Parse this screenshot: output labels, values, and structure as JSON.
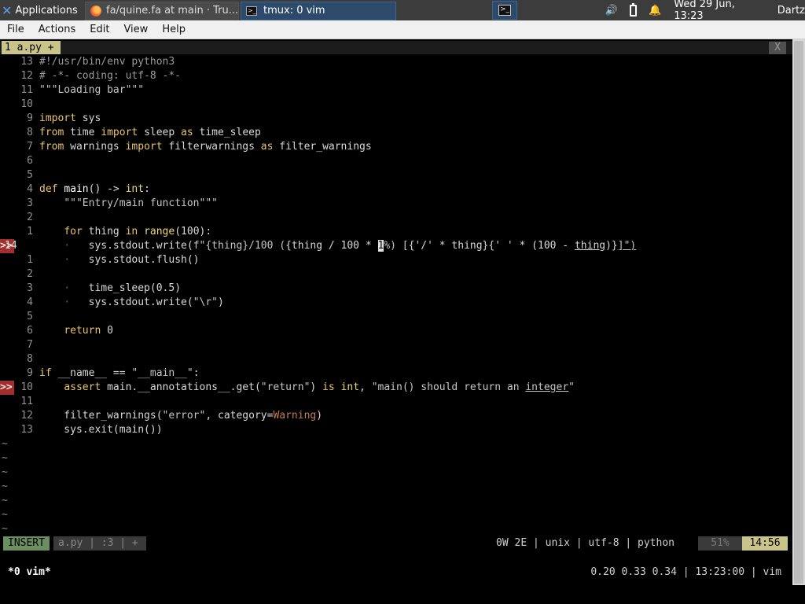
{
  "taskbar": {
    "apps_label": "Applications",
    "firefox_title": "fa/quine.fa at main · Tru...",
    "tmux_title": "tmux: 0 vim",
    "clock": "Wed 29 Jun, 13:23",
    "user": "Dartz"
  },
  "menubar": {
    "file": "File",
    "actions": "Actions",
    "edit": "Edit",
    "view": "View",
    "help": "Help"
  },
  "vim": {
    "tab_label": "1 a.py +",
    "tab_close": "X",
    "lines": [
      {
        "n": "13",
        "html": "<span class=\"cmt\">#!/usr/bin/env python3</span>"
      },
      {
        "n": "12",
        "html": "<span class=\"cmt\"># -*- coding: utf-8 -*-</span>"
      },
      {
        "n": "11",
        "html": "<span class=\"str\">\"\"\"Loading bar\"\"\"</span>"
      },
      {
        "n": "10",
        "html": ""
      },
      {
        "n": "9",
        "html": "<span class=\"kw\">import</span> sys"
      },
      {
        "n": "8",
        "html": "<span class=\"kw\">from</span> time <span class=\"kw\">import</span> sleep <span class=\"kw\">as</span> time_sleep"
      },
      {
        "n": "7",
        "html": "<span class=\"kw\">from</span> warnings <span class=\"kw\">import</span> filterwarnings <span class=\"kw\">as</span> filter_warnings"
      },
      {
        "n": "6",
        "html": ""
      },
      {
        "n": "5",
        "html": ""
      },
      {
        "n": "4",
        "html": "<span class=\"kw\">def</span> <span class=\"fn\">main</span>() -&gt; <span class=\"kw2\">int</span>:"
      },
      {
        "n": "3",
        "html": "    <span class=\"str\">\"\"\"Entry/main function\"\"\"</span>"
      },
      {
        "n": "2",
        "html": ""
      },
      {
        "n": "1",
        "html": "    <span class=\"kw\">for</span> thing <span class=\"kw\">in</span> <span class=\"kw2\">range</span>(100):"
      },
      {
        "n": "14",
        "cur": true,
        "sign": ">>",
        "html": "    <span class=\"dot\">·</span>   sys.stdout.write(<span class=\"str\">f\"{thing}/100 (</span>{thing / 100 * <span class=\"cursor\">1</span><span class=\"str\">%) [</span>{'/' * thing}{' ' * (100 - <span class=\"ul\">thing</span>)}<span class=\"str ul\">]\")</span>"
      },
      {
        "n": "1",
        "html": "    <span class=\"dot\">·</span>   sys.stdout.flush()"
      },
      {
        "n": "2",
        "html": ""
      },
      {
        "n": "3",
        "html": "    <span class=\"dot\">·</span>   time_sleep(0.5)"
      },
      {
        "n": "4",
        "html": "    <span class=\"dot\">·</span>   sys.stdout.write(<span class=\"str\">\"\\r\"</span>)"
      },
      {
        "n": "5",
        "html": ""
      },
      {
        "n": "6",
        "html": "    <span class=\"kw\">return</span> 0"
      },
      {
        "n": "7",
        "html": ""
      },
      {
        "n": "8",
        "html": ""
      },
      {
        "n": "9",
        "html": "<span class=\"kw\">if</span> __name__ == <span class=\"str\">\"__main__\"</span>:"
      },
      {
        "n": "10",
        "sign": ">>",
        "err": true,
        "html": "    <span class=\"kw\">assert</span> main.__annotations__.get(<span class=\"str\">\"return\"</span>) <span class=\"kw\">is</span> <span class=\"kw2\">int</span>, <span class=\"str\">\"main() should return an <span class=\"ul\">integer</span>\"</span>"
      },
      {
        "n": "11",
        "html": ""
      },
      {
        "n": "12",
        "html": "    filter_warnings(<span class=\"str\">\"error\"</span>, category=<span class=\"warnword\">Warning</span>)"
      },
      {
        "n": "13",
        "html": "    sys.exit(main())"
      }
    ],
    "tilde_count": 7,
    "status": {
      "mode": "INSERT",
      "file": "a.py | :3 | +",
      "right": "0W 2E | unix | utf-8 | python",
      "percent": "51%",
      "position": "14:56"
    }
  },
  "tmux": {
    "window": "*0 vim*",
    "right": "0.20 0.33 0.34 | 13:23:00 | vim"
  }
}
